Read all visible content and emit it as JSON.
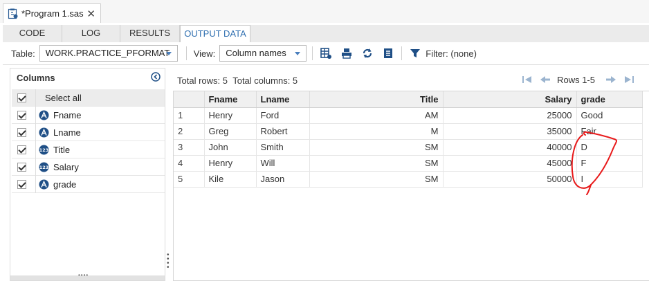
{
  "file_tab": {
    "name": "*Program 1.sas",
    "close_glyph": "✕"
  },
  "sub_tabs": [
    {
      "label": "CODE",
      "active": false
    },
    {
      "label": "LOG",
      "active": false
    },
    {
      "label": "RESULTS",
      "active": false
    },
    {
      "label": "OUTPUT DATA",
      "active": true
    }
  ],
  "toolbar": {
    "table_label": "Table:",
    "table_value": "WORK.PRACTICE_PFORMAT",
    "view_label": "View:",
    "view_value": "Column names",
    "filter_text": "Filter: (none)"
  },
  "columns_panel": {
    "title": "Columns",
    "select_all": "Select all",
    "items": [
      {
        "label": "Fname",
        "type": "char"
      },
      {
        "label": "Lname",
        "type": "char"
      },
      {
        "label": "Title",
        "type": "num"
      },
      {
        "label": "Salary",
        "type": "num"
      },
      {
        "label": "grade",
        "type": "char"
      }
    ]
  },
  "summary": {
    "total_rows": "Total rows: 5",
    "total_columns": "Total columns: 5",
    "rows_range": "Rows 1-5"
  },
  "grid": {
    "headers": [
      "Fname",
      "Lname",
      "Title",
      "Salary",
      "grade"
    ],
    "rows": [
      [
        "1",
        "Henry",
        "Ford",
        "AM",
        "25000",
        "Good"
      ],
      [
        "2",
        "Greg",
        "Robert",
        "M",
        "35000",
        "Fair"
      ],
      [
        "3",
        "John",
        "Smith",
        "SM",
        "40000",
        "D"
      ],
      [
        "4",
        "Henry",
        "Will",
        "SM",
        "45000",
        "F"
      ],
      [
        "5",
        "Kile",
        "Jason",
        "SM",
        "50000",
        "I"
      ]
    ]
  },
  "colors": {
    "accent": "#2f6fb0",
    "type_icon": "#1f4f86",
    "annotation": "#e8191a"
  }
}
